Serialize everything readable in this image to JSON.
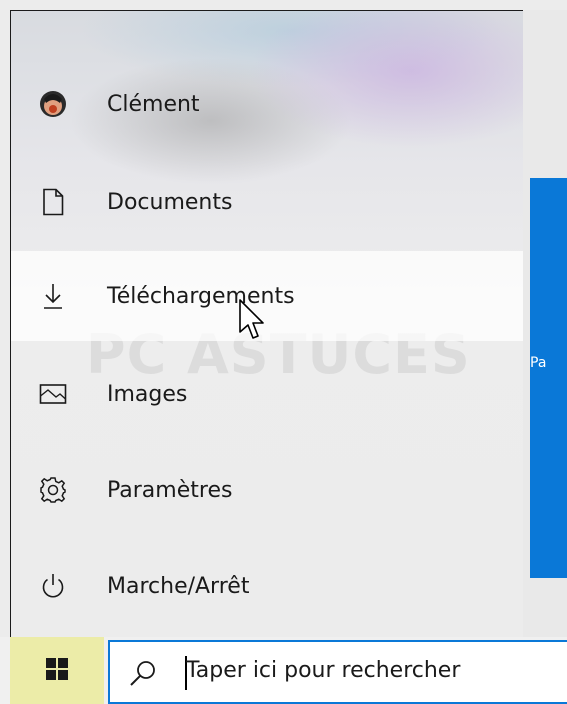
{
  "start_menu": {
    "items": [
      {
        "label": "Clément",
        "icon": "user-avatar"
      },
      {
        "label": "Documents",
        "icon": "document-icon"
      },
      {
        "label": "Téléchargements",
        "icon": "download-icon",
        "highlighted": true
      },
      {
        "label": "Images",
        "icon": "image-icon"
      },
      {
        "label": "Paramètres",
        "icon": "gear-icon"
      },
      {
        "label": "Marche/Arrêt",
        "icon": "power-icon"
      }
    ]
  },
  "tile": {
    "label": "Pa",
    "color": "#0a78d7"
  },
  "watermark": {
    "text": "PC ASTUCES"
  },
  "taskbar": {
    "start_icon": "windows-logo-icon",
    "search": {
      "placeholder": "Taper ici pour rechercher",
      "icon": "search-icon",
      "border_color": "#0a78d7"
    }
  }
}
